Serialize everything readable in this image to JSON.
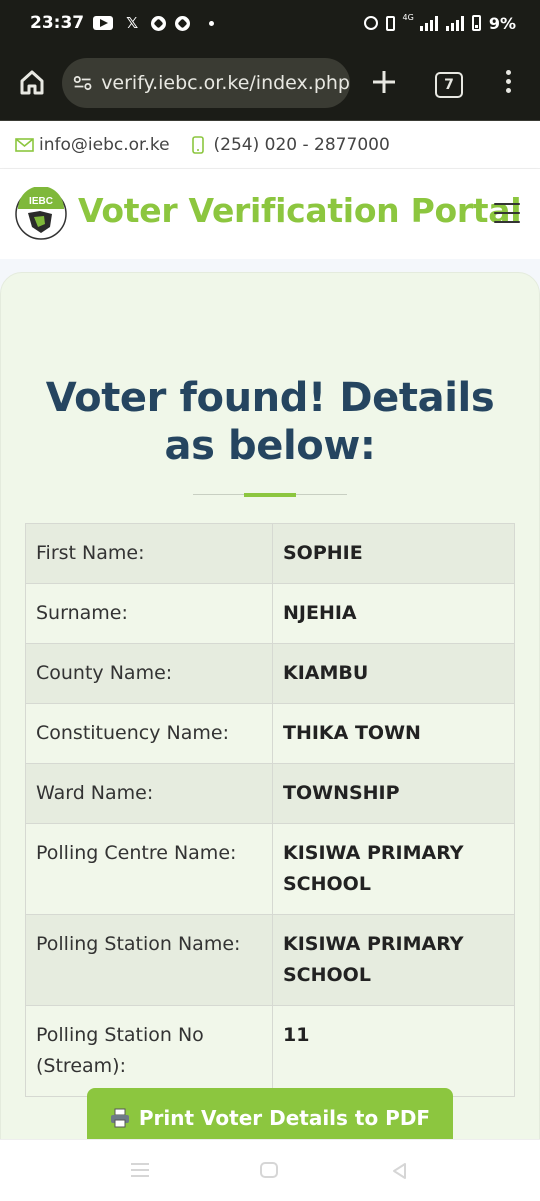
{
  "status_bar": {
    "time": "23:37",
    "network_label": "4G",
    "battery": "9%",
    "icons": [
      "youtube-icon",
      "x-icon",
      "soccer-ball-icon",
      "soccer-ball-icon",
      "dot-icon",
      "alarm-icon",
      "vibrate-icon",
      "signal-icon",
      "battery-icon"
    ]
  },
  "browser": {
    "url": "verify.iebc.or.ke/index.php",
    "tab_count": "7"
  },
  "contact": {
    "email": "info@iebc.or.ke",
    "phone": "(254) 020 - 2877000"
  },
  "header": {
    "logo_text": "IEBC",
    "title": "Voter Verification Portal"
  },
  "result": {
    "heading": "Voter found! Details as below:",
    "rows": [
      {
        "label": "First Name:",
        "value": "SOPHIE"
      },
      {
        "label": "Surname:",
        "value": "NJEHIA"
      },
      {
        "label": "County Name:",
        "value": "KIAMBU"
      },
      {
        "label": "Constituency Name:",
        "value": "THIKA TOWN"
      },
      {
        "label": "Ward Name:",
        "value": "TOWNSHIP"
      },
      {
        "label": "Polling Centre Name:",
        "value": "KISIWA PRIMARY SCHOOL"
      },
      {
        "label": "Polling Station Name:",
        "value": "KISIWA PRIMARY SCHOOL"
      },
      {
        "label": "Polling Station No (Stream):",
        "value": "11"
      }
    ],
    "print_label": "Print Voter Details to PDF"
  },
  "colors": {
    "brand_green": "#8cc63f",
    "heading_navy": "#254560",
    "card_bg": "#f0f7e9"
  }
}
